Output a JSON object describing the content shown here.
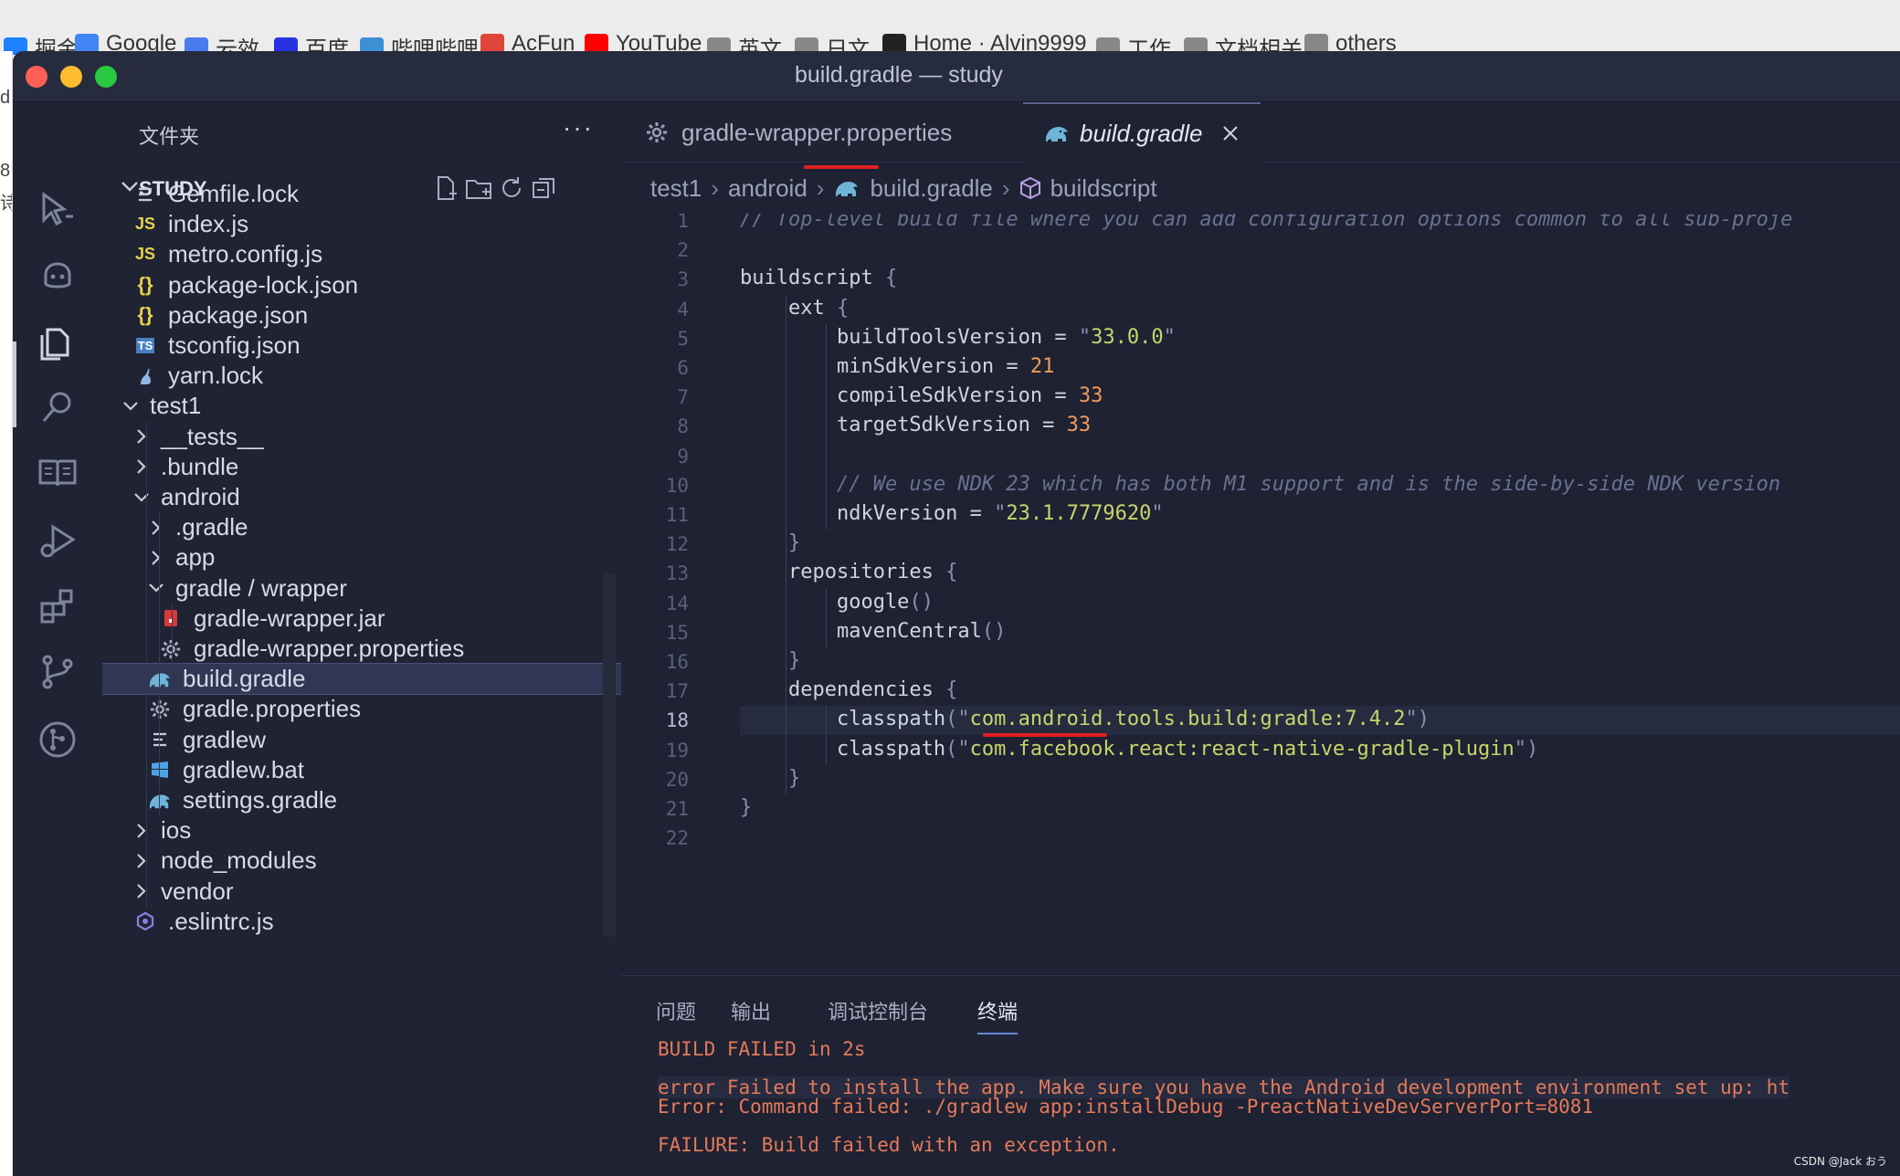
{
  "bookmarks": [
    {
      "label": "掘金",
      "color": "#1e80ff"
    },
    {
      "label": "Google",
      "color": "#4285f4"
    },
    {
      "label": "云效",
      "color": "#4b7bec"
    },
    {
      "label": "百度",
      "color": "#2932e1"
    },
    {
      "label": "哔哩哔哩",
      "color": "#3d8fd6"
    },
    {
      "label": "AcFun",
      "color": "#e0453a"
    },
    {
      "label": "YouTube",
      "color": "#ff0000"
    },
    {
      "label": "英文",
      "color": "#888888"
    },
    {
      "label": "日文",
      "color": "#888888"
    },
    {
      "label": "Home · Alvin9999",
      "color": "#222222"
    },
    {
      "label": "工作",
      "color": "#888888"
    },
    {
      "label": "文档相关",
      "color": "#888888"
    },
    {
      "label": "others",
      "color": "#888888"
    }
  ],
  "left_peek": [
    "d",
    "8",
    "诗"
  ],
  "window": {
    "title": "build.gradle — study",
    "traffic_lights": {
      "close": "#ff5f57",
      "minimize": "#febc2e",
      "zoom": "#28c840"
    }
  },
  "activity_bar": [
    {
      "name": "remote-pointer-icon"
    },
    {
      "name": "copilot-icon"
    },
    {
      "name": "explorer-icon",
      "active": true
    },
    {
      "name": "search-icon"
    },
    {
      "name": "book-icon"
    },
    {
      "name": "run-debug-icon"
    },
    {
      "name": "extensions-icon"
    },
    {
      "name": "source-control-icon"
    },
    {
      "name": "git-graph-icon"
    }
  ],
  "sidebar": {
    "title": "文件夹",
    "more": "···",
    "workspace": "STUDY",
    "tree": [
      {
        "label": "Gemfile.lock",
        "icon": "lines",
        "depth": 1
      },
      {
        "label": "index.js",
        "icon": "js",
        "depth": 1
      },
      {
        "label": "metro.config.js",
        "icon": "js",
        "depth": 1
      },
      {
        "label": "package-lock.json",
        "icon": "json",
        "depth": 1
      },
      {
        "label": "package.json",
        "icon": "json",
        "depth": 1
      },
      {
        "label": "tsconfig.json",
        "icon": "ts",
        "depth": 1
      },
      {
        "label": "yarn.lock",
        "icon": "yarn",
        "depth": 1
      },
      {
        "label": "test1",
        "icon": "folder-open",
        "depth": 0
      },
      {
        "label": "__tests__",
        "icon": "folder",
        "depth": 1
      },
      {
        "label": ".bundle",
        "icon": "folder",
        "depth": 1
      },
      {
        "label": "android",
        "icon": "folder-open",
        "depth": 1
      },
      {
        "label": ".gradle",
        "icon": "folder",
        "depth": 2
      },
      {
        "label": "app",
        "icon": "folder",
        "depth": 2
      },
      {
        "label": "gradle / wrapper",
        "icon": "folder-open",
        "depth": 2
      },
      {
        "label": "gradle-wrapper.jar",
        "icon": "jar",
        "depth": 3
      },
      {
        "label": "gradle-wrapper.properties",
        "icon": "gear",
        "depth": 3
      },
      {
        "label": "build.gradle",
        "icon": "gradle",
        "depth": 2,
        "selected": true
      },
      {
        "label": "gradle.properties",
        "icon": "gear",
        "depth": 2
      },
      {
        "label": "gradlew",
        "icon": "lines",
        "depth": 2
      },
      {
        "label": "gradlew.bat",
        "icon": "windows",
        "depth": 2
      },
      {
        "label": "settings.gradle",
        "icon": "gradle",
        "depth": 2
      },
      {
        "label": "ios",
        "icon": "folder",
        "depth": 1
      },
      {
        "label": "node_modules",
        "icon": "folder",
        "depth": 1
      },
      {
        "label": "vendor",
        "icon": "folder",
        "depth": 1
      },
      {
        "label": ".eslintrc.js",
        "icon": "eslint",
        "depth": 1
      }
    ]
  },
  "tabs": [
    {
      "label": "gradle-wrapper.properties"
    },
    {
      "label": "build.gradle",
      "active": true
    }
  ],
  "breadcrumb": [
    "test1",
    "android",
    "build.gradle",
    "buildscript"
  ],
  "editor": {
    "active_line": 18,
    "lines": [
      {
        "n": "1",
        "text": "// Top-level build file where you can add configuration options common to all sub-proje",
        "kind": "comment"
      },
      {
        "n": "2",
        "text": ""
      },
      {
        "n": "3",
        "text": "buildscript {"
      },
      {
        "n": "4",
        "text": "    ext {"
      },
      {
        "n": "5",
        "text": "        buildToolsVersion = \"33.0.0\""
      },
      {
        "n": "6",
        "text": "        minSdkVersion = 21"
      },
      {
        "n": "7",
        "text": "        compileSdkVersion = 33"
      },
      {
        "n": "8",
        "text": "        targetSdkVersion = 33"
      },
      {
        "n": "9",
        "text": ""
      },
      {
        "n": "10",
        "text": "        // We use NDK 23 which has both M1 support and is the side-by-side NDK version",
        "kind": "comment"
      },
      {
        "n": "11",
        "text": "        ndkVersion = \"23.1.7779620\""
      },
      {
        "n": "12",
        "text": "    }"
      },
      {
        "n": "13",
        "text": "    repositories {"
      },
      {
        "n": "14",
        "text": "        google()"
      },
      {
        "n": "15",
        "text": "        mavenCentral()"
      },
      {
        "n": "16",
        "text": "    }"
      },
      {
        "n": "17",
        "text": "    dependencies {"
      },
      {
        "n": "18",
        "text": "        classpath(\"com.android.tools.build:gradle:7.4.2\")"
      },
      {
        "n": "19",
        "text": "        classpath(\"com.facebook.react:react-native-gradle-plugin\")"
      },
      {
        "n": "20",
        "text": "    }"
      },
      {
        "n": "21",
        "text": "}"
      },
      {
        "n": "22",
        "text": ""
      }
    ]
  },
  "panel": {
    "tabs": [
      "问题",
      "输出",
      "调试控制台",
      "终端"
    ],
    "active_tab": "终端",
    "terminal": [
      "BUILD FAILED in 2s",
      "",
      "error Failed to install the app. Make sure you have the Android development environment set up: ht",
      "Error: Command failed: ./gradlew app:installDebug -PreactNativeDevServerPort=8081",
      "",
      "FAILURE: Build failed with an exception."
    ]
  },
  "watermark": "CSDN @Jack おう"
}
